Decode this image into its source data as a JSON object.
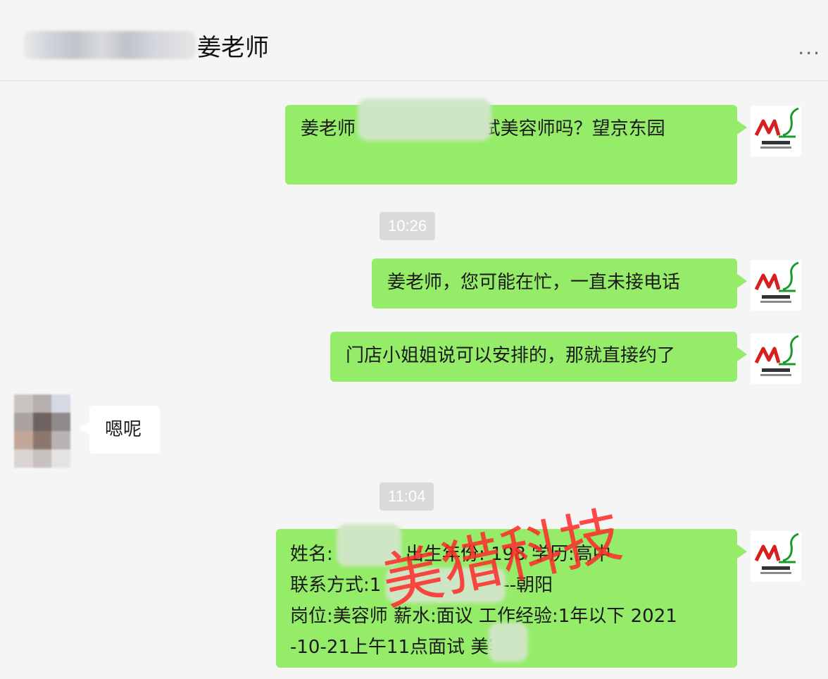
{
  "window": {
    "pin_icon": "pin-icon",
    "minimize_icon": "minimize-icon",
    "maximize_icon": "maximize-icon",
    "close_icon": "close-icon"
  },
  "header": {
    "title": "姜老师",
    "more": "..."
  },
  "messages": [
    {
      "direction": "out",
      "text": "姜老师         上   11点可以面试美容师吗？望京东园"
    },
    {
      "type": "time",
      "text": "10:26"
    },
    {
      "direction": "out",
      "text": "姜老师，您可能在忙，一直未接电话"
    },
    {
      "direction": "out",
      "text": "门店小姐姐说可以安排的，那就直接约了"
    },
    {
      "direction": "in",
      "text": "嗯呢"
    },
    {
      "type": "time",
      "text": "11:04"
    },
    {
      "direction": "out",
      "lines": [
        "姓名:        性别:女 出生年份: 198  学历:高中",
        "联系方式:1          工作地点:北京--朝阳",
        "岗位:美容师 薪水:面议 工作经验:1年以下 2021",
        "-10-21上午11点面试      美容师"
      ]
    }
  ],
  "avatar_text": "ML",
  "watermark": "美猎科技",
  "colors": {
    "outgoing": "#95ec69",
    "incoming": "#ffffff",
    "background": "#f5f5f5",
    "watermark": "#ff2a2a"
  }
}
